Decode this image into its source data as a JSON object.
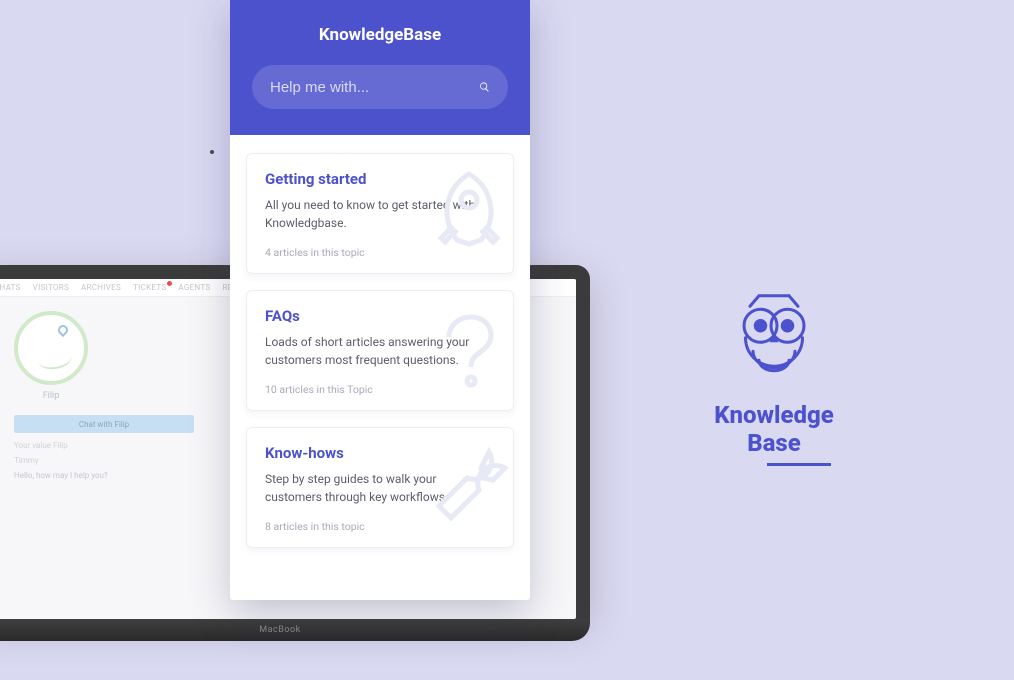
{
  "widget": {
    "title": "KnowledgeBase",
    "search_placeholder": "Help me with...",
    "icons": {
      "search": "search-icon"
    }
  },
  "cards": [
    {
      "title": "Getting started",
      "desc": "All you need to know to get started with Knowledgbase.",
      "meta": "4 articles in this topic",
      "icon": "rocket-icon"
    },
    {
      "title": "FAQs",
      "desc": "Loads of short articles answering your customers most frequent questions.",
      "meta": "10 articles in this Topic",
      "icon": "question-icon"
    },
    {
      "title": "Know-hows",
      "desc": "Step by step guides to walk your customers through key workflows.",
      "meta": "8 articles in this topic",
      "icon": "wrench-icon"
    }
  ],
  "brand": {
    "line1": "Knowledge",
    "line2": "Base"
  },
  "laptop": {
    "model": "MacBook",
    "nav": [
      "CHATS",
      "VISITORS",
      "ARCHIVES",
      "TICKETS",
      "AGENTS",
      "RE"
    ],
    "visitor_name": "Filip",
    "ribbon": "Chat with Filip",
    "field_label": "Your value Filip",
    "agent_label": "Timmy",
    "bubble": "Hello, how may I help you?"
  }
}
